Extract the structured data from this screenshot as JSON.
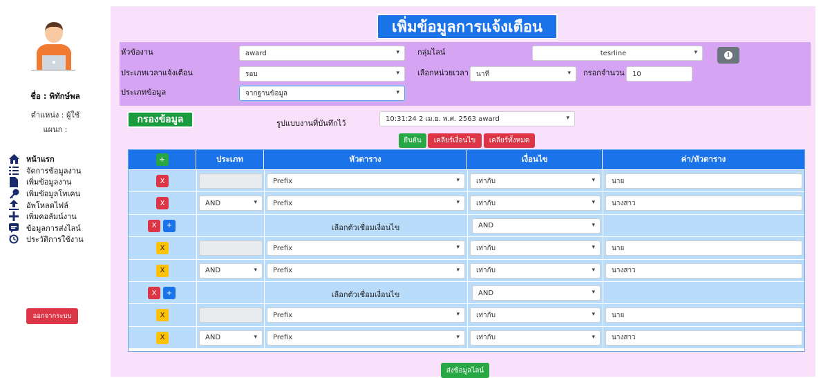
{
  "page_title": "เพิ่มข้อมูลการแจ้งเตือน",
  "profile": {
    "name": "ชื่อ : พิทักษ์พล",
    "position": "ตำแหน่ง : ผู้ใช้",
    "department": "แผนก :"
  },
  "menu": [
    {
      "label": "หน้าแรก",
      "icon": "home-icon"
    },
    {
      "label": "จัดการข้อมูลงาน",
      "icon": "list-icon"
    },
    {
      "label": "เพิ่มข้อมูลงาน",
      "icon": "file-icon"
    },
    {
      "label": "เพิ่มข้อมูลโทเคน",
      "icon": "key-icon"
    },
    {
      "label": "อัพโหลดไฟล์",
      "icon": "upload-icon"
    },
    {
      "label": "เพิ่มคอลัมน์งาน",
      "icon": "plus-icon"
    },
    {
      "label": "ข้อมูลการส่งไลน์",
      "icon": "chat-icon"
    },
    {
      "label": "ประวัติการใช้งาน",
      "icon": "history-icon"
    }
  ],
  "logout_label": "ออกจากระบบ",
  "form": {
    "topic_label": "หัวข้องาน",
    "topic_value": "award",
    "line_group_label": "กลุ่มไลน์",
    "line_group_value": "tesrline",
    "alert_time_type_label": "ประเภทเวลาแจ้งเตือน",
    "alert_time_type_value": "รอบ",
    "time_unit_label": "เลือกหน่วยเวลา",
    "time_unit_value": "นาที",
    "amount_label": "กรอกจำนวน",
    "amount_value": "10",
    "data_type_label": "ประเภทข้อมูล",
    "data_type_value": "จากฐานข้อมูล"
  },
  "filter": {
    "title": "กรองข้อมูล",
    "saved_label": "รูปแบบงานที่บันทึกไว้",
    "saved_value": "10:31:24 2 เม.ย. พ.ศ. 2563 award",
    "confirm": "ยืนยัน",
    "clear_condition": "เคลียร์เงื่อนไข",
    "clear_all": "เคลียร์ทั้งหมด"
  },
  "table": {
    "headers": [
      "+",
      "ประเภท",
      "หัวตาราง",
      "เงื่อนไข",
      "ค่า/หัวตาราง"
    ],
    "connector_label": "เลือกตัวเชื่อมเงื่อนไข",
    "rows": [
      {
        "kind": "cond",
        "btn": "red",
        "type": "",
        "column": "Prefix",
        "condition": "เท่ากับ",
        "value": "นาย"
      },
      {
        "kind": "cond",
        "btn": "red",
        "type": "AND",
        "column": "Prefix",
        "condition": "เท่ากับ",
        "value": "นางสาว"
      },
      {
        "kind": "conn",
        "connector": "AND"
      },
      {
        "kind": "cond",
        "btn": "yellow",
        "type": "",
        "column": "Prefix",
        "condition": "เท่ากับ",
        "value": "นาย"
      },
      {
        "kind": "cond",
        "btn": "yellow",
        "type": "AND",
        "column": "Prefix",
        "condition": "เท่ากับ",
        "value": "นางสาว"
      },
      {
        "kind": "conn",
        "connector": "AND"
      },
      {
        "kind": "cond",
        "btn": "yellow",
        "type": "",
        "column": "Prefix",
        "condition": "เท่ากับ",
        "value": "นาย"
      },
      {
        "kind": "cond",
        "btn": "yellow",
        "type": "AND",
        "column": "Prefix",
        "condition": "เท่ากับ",
        "value": "นางสาว"
      }
    ],
    "remove_label": "X",
    "add_label": "+"
  },
  "send_label": "ส่งข้อมูลไลน์",
  "colors": {
    "primary": "#1a73e8",
    "danger": "#dc3545",
    "success": "#28a745",
    "warning": "#ffc107",
    "panel": "#d5a5f4",
    "bg": "#f9e1fb"
  }
}
